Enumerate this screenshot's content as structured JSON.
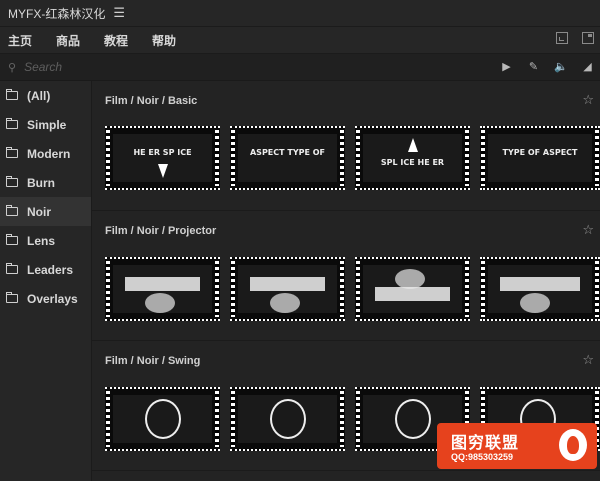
{
  "app": {
    "title": "MYFX-红森林汉化",
    "menu_icon": "hamburger-icon"
  },
  "nav": {
    "items": [
      "主页",
      "商品",
      "教程",
      "帮助"
    ],
    "right_icons": [
      "minimize-icon",
      "restore-icon"
    ]
  },
  "search": {
    "placeholder": "Search",
    "value": "",
    "tools": [
      "play-icon",
      "brush-icon",
      "volume-icon",
      "collapse-icon"
    ]
  },
  "sidebar": {
    "items": [
      {
        "label": "(All)"
      },
      {
        "label": "Simple"
      },
      {
        "label": "Modern"
      },
      {
        "label": "Burn"
      },
      {
        "label": "Noir",
        "active": true
      },
      {
        "label": "Lens"
      },
      {
        "label": "Leaders"
      },
      {
        "label": "Overlays"
      }
    ]
  },
  "sections": [
    {
      "title": "Film / Noir / Basic",
      "captions": [
        "HE ER SP ICE",
        "ASPECT TYPE OF",
        "SPL ICE HE ER",
        "TYPE OF ASPECT"
      ]
    },
    {
      "title": "Film / Noir / Projector",
      "captions": [
        "",
        "",
        "",
        ""
      ]
    },
    {
      "title": "Film / Noir / Swing",
      "captions": [
        "",
        "",
        "",
        ""
      ]
    }
  ],
  "watermark": {
    "title": "图穷联盟",
    "qq": "QQ:985303259"
  },
  "colors": {
    "background": "#232323",
    "panel": "#262626",
    "active_item": "#333333",
    "watermark": "#e6421d"
  }
}
